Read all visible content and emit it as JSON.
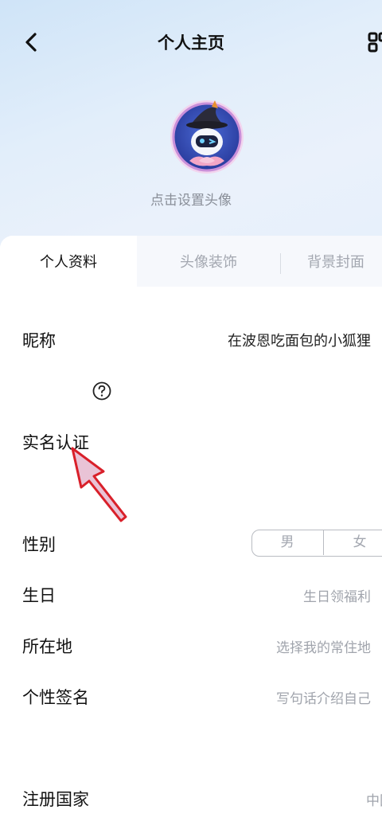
{
  "header": {
    "title": "个人主页",
    "back_icon": "chevron-left-icon",
    "qr_icon": "qr-code-icon"
  },
  "profile": {
    "avatar_hint": "点击设置头像"
  },
  "tabs": [
    {
      "label": "个人资料",
      "active": true
    },
    {
      "label": "头像装饰",
      "active": false
    },
    {
      "label": "背景封面",
      "active": false
    }
  ],
  "fields": {
    "nickname": {
      "label": "昵称",
      "value": "在波恩吃面包的小狐狸"
    },
    "realname": {
      "label": "实名认证"
    },
    "gender": {
      "label": "性别",
      "options": [
        "男",
        "女"
      ]
    },
    "birthday": {
      "label": "生日",
      "placeholder": "生日领福利"
    },
    "location": {
      "label": "所在地",
      "placeholder": "选择我的常住地"
    },
    "signature": {
      "label": "个性签名",
      "placeholder": "写句话介绍自己"
    },
    "country": {
      "label": "注册国家",
      "value": "中国"
    }
  },
  "annotation": {
    "arrow_color": "#d9202a"
  }
}
